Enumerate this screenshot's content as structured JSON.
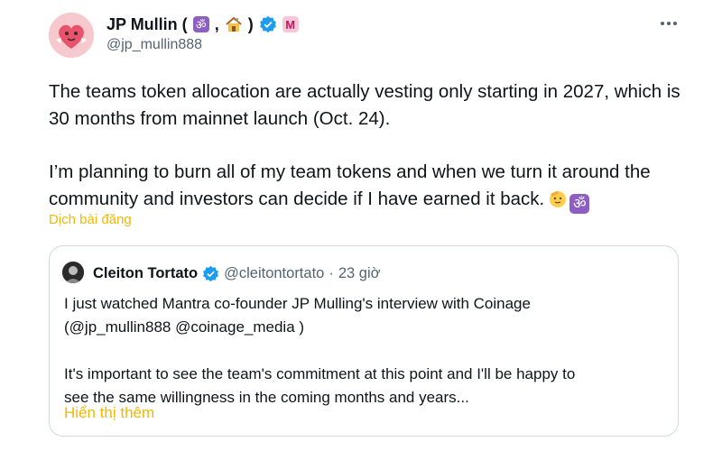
{
  "tweet": {
    "display_name": "JP Mullin (",
    "name_comma": ",",
    "name_close": ")",
    "handle": "@jp_mullin888",
    "badge_letter": "M",
    "om_glyph": "ॐ",
    "paragraph_1": "The teams token allocation are actually vesting only starting in 2027, which is 30 months from mainnet launch (Oct. 24).",
    "paragraph_2": "I’m planning to burn all of my team tokens and when we turn it around the community and investors can decide if I have earned it back.",
    "translate_label": "Dịch bài đăng"
  },
  "quote": {
    "name": "Cleiton Tortato",
    "handle": "@cleitontortato",
    "separator": "·",
    "time": "23 giờ",
    "line_1": "I just watched Mantra co-founder JP Mulling's interview with Coinage",
    "line_2": "(@jp_mullin888 @coinage_media )",
    "line_3": "It's important to see the team's commitment at this point and I'll be happy to",
    "line_4": "see the same willingness in the coming months and years...",
    "show_more_label": "Hiển thị thêm"
  },
  "colors": {
    "accent_link": "#f2b705",
    "verified_blue": "#1d9bf0",
    "secondary_text": "#536471",
    "border": "#cfd9de"
  },
  "icons": [
    "avatar",
    "om-icon",
    "house-icon",
    "verified-icon",
    "m-badge-icon",
    "more-icon",
    "saluting-face-icon"
  ]
}
